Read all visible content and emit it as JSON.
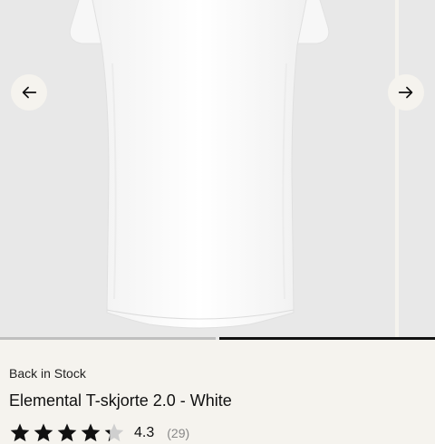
{
  "gallery": {
    "prev_icon": "arrow-left-icon",
    "next_icon": "arrow-right-icon",
    "slide_count": 2,
    "active_slide": 2
  },
  "product": {
    "stock_status": "Back in Stock",
    "title": "Elemental T-skjorte 2.0 - White",
    "rating": "4.3",
    "review_count": "(29)",
    "rating_value": 4.3,
    "rating_max": 5
  },
  "colors": {
    "background": "#f5f3ee",
    "image_bg": "#e8e8e8",
    "progress_active": "#111111",
    "progress_inactive": "#bfbfbf"
  }
}
